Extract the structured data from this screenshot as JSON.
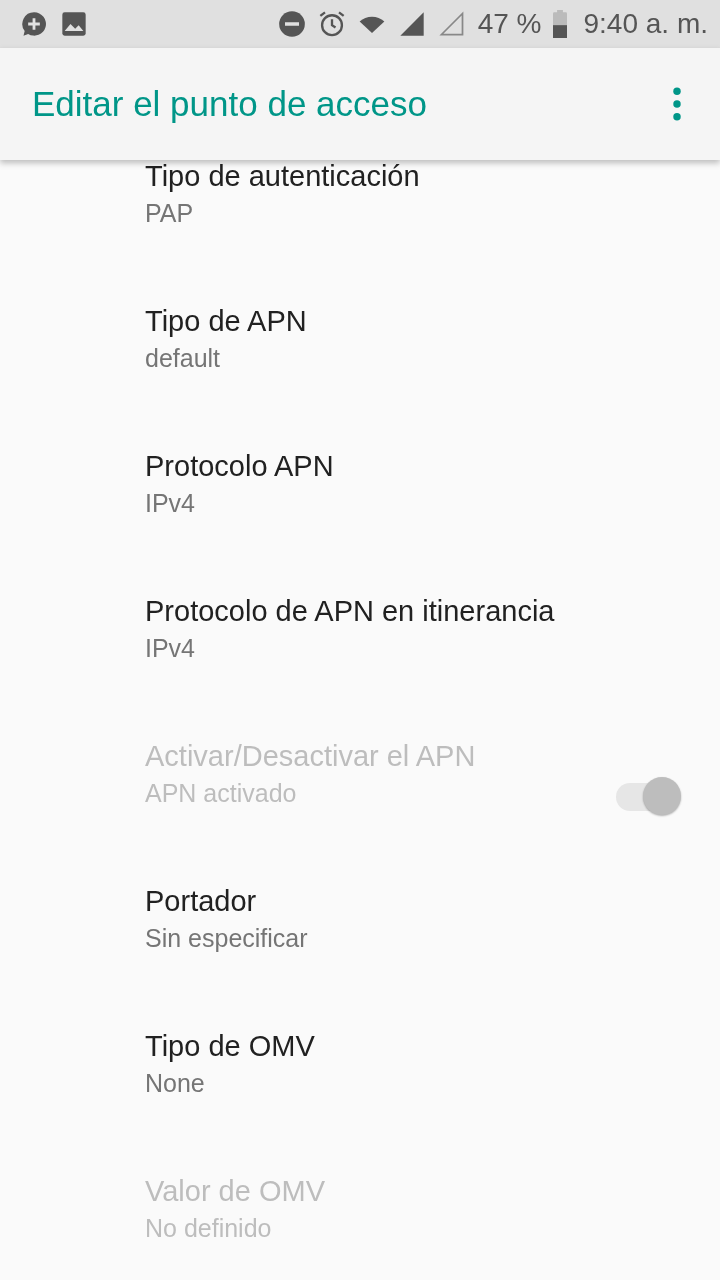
{
  "status_bar": {
    "battery": "47 %",
    "time": "9:40 a. m."
  },
  "app_bar": {
    "title": "Editar el punto de acceso"
  },
  "items": [
    {
      "kind": "text",
      "title": "Tipo de autenticación",
      "summary": "PAP",
      "disabled": false
    },
    {
      "kind": "text",
      "title": "Tipo de APN",
      "summary": "default",
      "disabled": false
    },
    {
      "kind": "text",
      "title": "Protocolo APN",
      "summary": "IPv4",
      "disabled": false
    },
    {
      "kind": "text",
      "title": "Protocolo de APN en itinerancia",
      "summary": "IPv4",
      "disabled": false
    },
    {
      "kind": "switch",
      "title": "Activar/Desactivar el APN",
      "summary": "APN activado",
      "disabled": true,
      "on": true
    },
    {
      "kind": "text",
      "title": "Portador",
      "summary": "Sin especificar",
      "disabled": false
    },
    {
      "kind": "text",
      "title": "Tipo de OMV",
      "summary": "None",
      "disabled": false
    },
    {
      "kind": "text",
      "title": "Valor de OMV",
      "summary": "No definido",
      "disabled": true
    }
  ]
}
